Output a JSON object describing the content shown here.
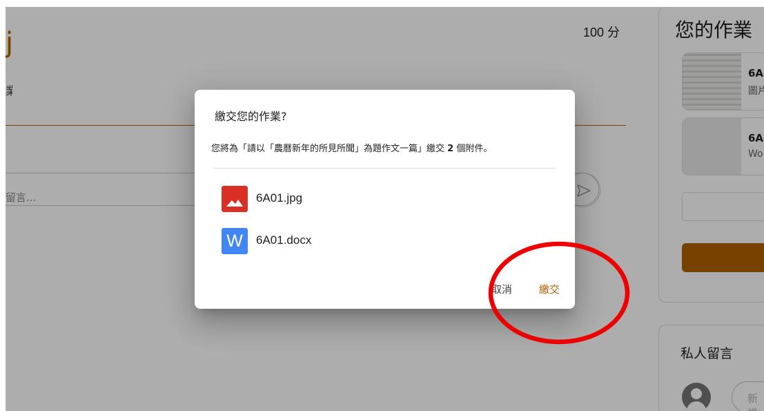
{
  "background": {
    "title_partial": "j",
    "subtitle_partial": "業",
    "points": "100 分",
    "comment_placeholder": "留言..."
  },
  "your_work": {
    "title": "您的作業",
    "attachments": [
      {
        "name": "6A",
        "type": "圖片"
      },
      {
        "name": "6A",
        "type": "Wo"
      }
    ]
  },
  "private_comments": {
    "title": "私人留言",
    "placeholder": "新增"
  },
  "dialog": {
    "title": "繳交您的作業?",
    "message_before": "您將為「請以「農曆新年的所見所聞」為題作文一篇」繳交 ",
    "attachment_count": "2",
    "message_after": " 個附件。",
    "files": [
      {
        "name": "6A01.jpg",
        "icon": "image-file-icon"
      },
      {
        "name": "6A01.docx",
        "icon": "word-file-icon",
        "glyph": "W"
      }
    ],
    "cancel_label": "取消",
    "submit_label": "繳交"
  },
  "colors": {
    "accent": "#b06000",
    "jpg_icon": "#d93025",
    "doc_icon": "#4285f4",
    "annotation": "#ee0000"
  }
}
